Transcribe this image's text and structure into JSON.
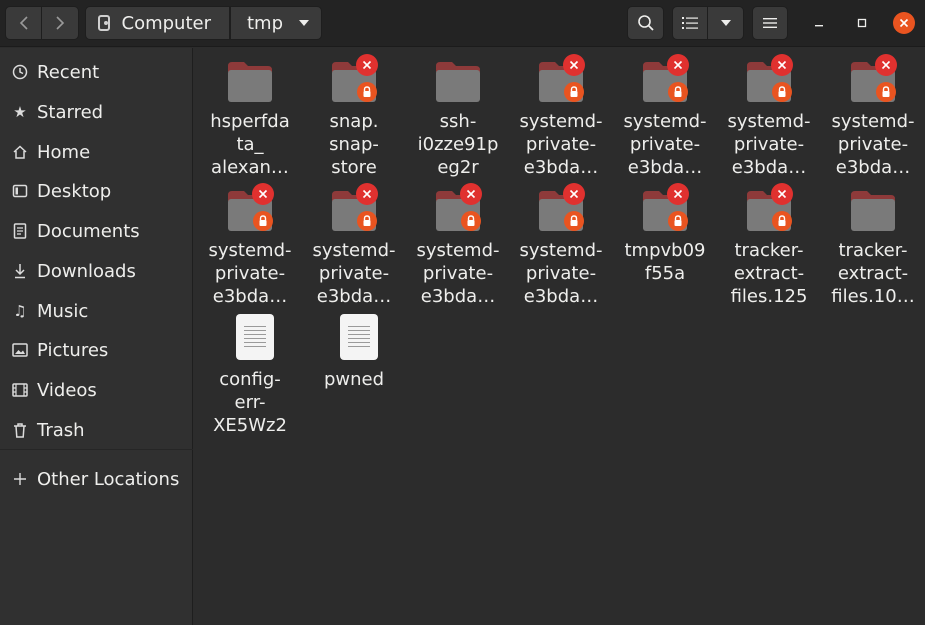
{
  "header": {
    "back_icon": "chevron-left-icon",
    "forward_icon": "chevron-right-icon",
    "path": [
      "Computer",
      "tmp"
    ],
    "search_icon": "search-icon",
    "view_icon": "list-view-icon",
    "menu_icon": "hamburger-menu-icon"
  },
  "sidebar": {
    "items": [
      {
        "label": "Recent",
        "icon": "clock-icon"
      },
      {
        "label": "Starred",
        "icon": "star-icon"
      },
      {
        "label": "Home",
        "icon": "home-icon"
      },
      {
        "label": "Desktop",
        "icon": "desktop-icon"
      },
      {
        "label": "Documents",
        "icon": "document-icon"
      },
      {
        "label": "Downloads",
        "icon": "download-icon"
      },
      {
        "label": "Music",
        "icon": "music-icon"
      },
      {
        "label": "Pictures",
        "icon": "picture-icon"
      },
      {
        "label": "Videos",
        "icon": "video-icon"
      },
      {
        "label": "Trash",
        "icon": "trash-icon"
      }
    ],
    "other_locations": {
      "label": "Other Locations",
      "icon": "plus-icon"
    }
  },
  "files": [
    {
      "lines": [
        "hsperfda",
        "ta_",
        "alexan…"
      ],
      "kind": "folder",
      "locked": false
    },
    {
      "lines": [
        "snap.",
        "snap-",
        "store"
      ],
      "kind": "folder",
      "locked": true
    },
    {
      "lines": [
        "ssh-",
        "i0zze91p",
        "eg2r"
      ],
      "kind": "folder",
      "locked": false
    },
    {
      "lines": [
        "systemd-",
        "private-",
        "e3bda…"
      ],
      "kind": "folder",
      "locked": true
    },
    {
      "lines": [
        "systemd-",
        "private-",
        "e3bda…"
      ],
      "kind": "folder",
      "locked": true
    },
    {
      "lines": [
        "systemd-",
        "private-",
        "e3bda…"
      ],
      "kind": "folder",
      "locked": true
    },
    {
      "lines": [
        "systemd-",
        "private-",
        "e3bda…"
      ],
      "kind": "folder",
      "locked": true
    },
    {
      "lines": [
        "systemd-",
        "private-",
        "e3bda…"
      ],
      "kind": "folder",
      "locked": true
    },
    {
      "lines": [
        "systemd-",
        "private-",
        "e3bda…"
      ],
      "kind": "folder",
      "locked": true
    },
    {
      "lines": [
        "systemd-",
        "private-",
        "e3bda…"
      ],
      "kind": "folder",
      "locked": true
    },
    {
      "lines": [
        "systemd-",
        "private-",
        "e3bda…"
      ],
      "kind": "folder",
      "locked": true
    },
    {
      "lines": [
        "tmpvb09",
        "f55a"
      ],
      "kind": "folder",
      "locked": true
    },
    {
      "lines": [
        "tracker-",
        "extract-",
        "files.125"
      ],
      "kind": "folder",
      "locked": true
    },
    {
      "lines": [
        "tracker-",
        "extract-",
        "files.10…"
      ],
      "kind": "folder",
      "locked": false
    },
    {
      "lines": [
        "config-",
        "err-",
        "XE5Wz2"
      ],
      "kind": "file",
      "locked": false
    },
    {
      "lines": [
        "pwned"
      ],
      "kind": "file",
      "locked": false
    }
  ],
  "colors": {
    "folder_body": "#7a7a7a",
    "folder_tab": "#8e3a3a",
    "emblem_unreadable": "#e0312f",
    "emblem_locked": "#e95420",
    "close_button": "#e95420"
  }
}
